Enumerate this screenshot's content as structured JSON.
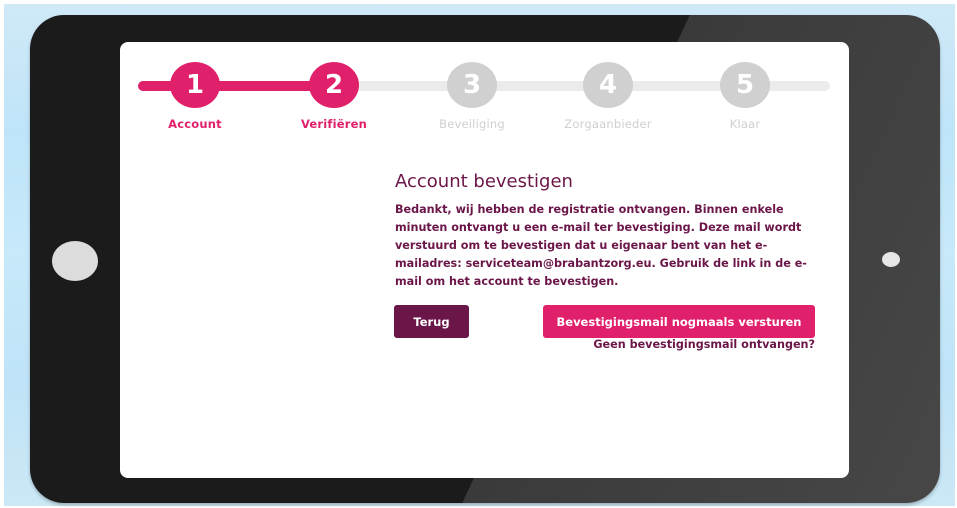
{
  "colors": {
    "accent_pink": "#e0206b",
    "dark_plum": "#6b1648",
    "inactive_gray": "#d0d0d0"
  },
  "steps": [
    {
      "number": "1",
      "label": "Account",
      "state": "done"
    },
    {
      "number": "2",
      "label": "Verifiëren",
      "state": "done"
    },
    {
      "number": "3",
      "label": "Beveiliging",
      "state": "todo"
    },
    {
      "number": "4",
      "label": "Zorgaanbieder",
      "state": "todo"
    },
    {
      "number": "5",
      "label": "Klaar",
      "state": "todo"
    }
  ],
  "main": {
    "title": "Account bevestigen",
    "text_before_email": "Bedankt, wij hebben de registratie ontvangen. Binnen enkele minuten ontvangt u een e-mail ter bevestiging. Deze mail wordt verstuurd om te bevestigen dat u eigenaar bent van het e-mailadres: ",
    "email": "serviceteam@brabantzorg.eu",
    "text_after_email": ". Gebruik de link in de e-mail om het account te bevestigen."
  },
  "actions": {
    "back_label": "Terug",
    "resend_label": "Bevestigingsmail nogmaals versturen",
    "not_received_link": "Geen bevestigingsmail ontvangen?"
  }
}
